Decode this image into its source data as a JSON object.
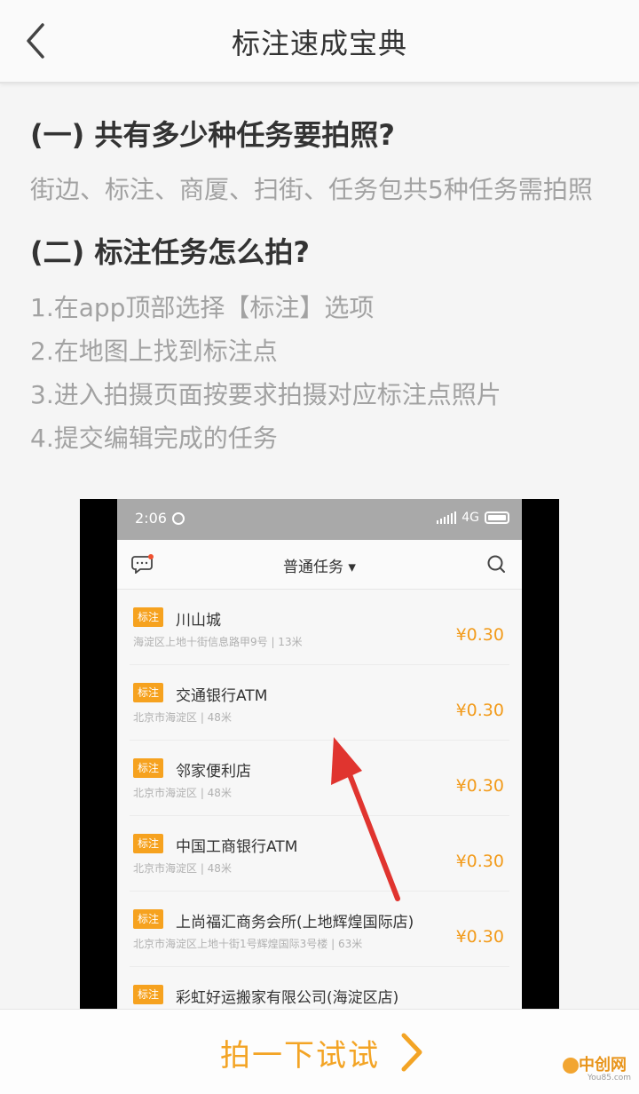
{
  "header": {
    "title": "标注速成宝典",
    "back_icon": "chevron-left-icon"
  },
  "content": {
    "q1_heading": "(一) 共有多少种任务要拍照?",
    "q1_answer": "街边、标注、商厦、扫街、任务包共5种任务需拍照",
    "q2_heading": "(二) 标注任务怎么拍?",
    "steps": [
      "1.在app顶部选择【标注】选项",
      "2.在地图上找到标注点",
      "3.进入拍摄页面按要求拍摄对应标注点照片",
      "4.提交编辑完成的任务"
    ]
  },
  "phone": {
    "status_time": "2:06",
    "network": "4G",
    "appbar_title": "普通任务 ▾",
    "tasks": [
      {
        "tag": "标注",
        "name": "川山城",
        "address": "海淀区上地十街信息路甲9号 | 13米",
        "price": "¥0.30"
      },
      {
        "tag": "标注",
        "name": "交通银行ATM",
        "address": "北京市海淀区 | 48米",
        "price": "¥0.30"
      },
      {
        "tag": "标注",
        "name": "邻家便利店",
        "address": "北京市海淀区 | 48米",
        "price": "¥0.30"
      },
      {
        "tag": "标注",
        "name": "中国工商银行ATM",
        "address": "北京市海淀区 | 48米",
        "price": "¥0.30"
      },
      {
        "tag": "标注",
        "name": "上尚福汇商务会所(上地辉煌国际店)",
        "address": "北京市海淀区上地十街1号辉煌国际3号楼 | 63米",
        "price": "¥0.30"
      },
      {
        "tag": "标注",
        "name": "彩虹好运搬家有限公司(海淀区店)",
        "address": "",
        "price": ""
      }
    ]
  },
  "bottom": {
    "cta_label": "拍一下试试",
    "cta_icon": "chevron-right-icon"
  },
  "watermark": {
    "text": "中创网",
    "sub": "You85.com"
  },
  "colors": {
    "accent": "#f3a425",
    "tag": "#f6a21f",
    "arrow": "#e0342f"
  }
}
